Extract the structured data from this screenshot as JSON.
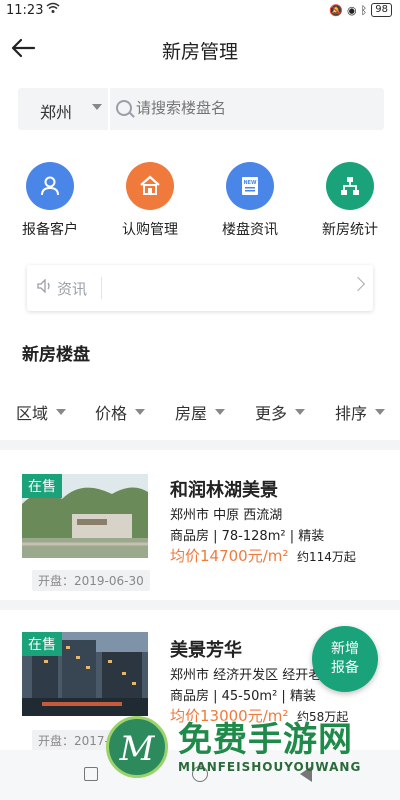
{
  "status_bar": {
    "time": "11:23",
    "battery": "98"
  },
  "header": {
    "title": "新房管理"
  },
  "search": {
    "city": "郑州",
    "placeholder": "请搜索楼盘名"
  },
  "quick_actions": [
    {
      "label": "报备客户",
      "icon": "user-icon",
      "color": "#4a86e8"
    },
    {
      "label": "认购管理",
      "icon": "house-icon",
      "color": "#f07a3c"
    },
    {
      "label": "楼盘资讯",
      "icon": "news-icon",
      "color": "#4a86e8"
    },
    {
      "label": "新房统计",
      "icon": "org-chart-icon",
      "color": "#1aa37a"
    }
  ],
  "news": {
    "label": "资讯"
  },
  "section": {
    "title": "新房楼盘"
  },
  "filters": [
    "区域",
    "价格",
    "房屋",
    "更多",
    "排序"
  ],
  "listings": [
    {
      "badge": "在售",
      "name": "和润林湖美景",
      "location": "郑州市 中原 西流湖",
      "type": "商品房 | 78-128m² | 精装",
      "price": "均价14700元/m²",
      "total": "约114万起",
      "open_date": "开盘：2019-06-30"
    },
    {
      "badge": "在售",
      "name": "美景芳华",
      "location": "郑州市 经济开发区 经开老",
      "type": "商品房 | 45-50m² | 精装",
      "price": "均价13000元/m²",
      "total": "约58万起",
      "open_date": "开盘：2017-10"
    }
  ],
  "fab": {
    "line1": "新增",
    "line2": "报备"
  },
  "watermark": {
    "title": "免费手游网",
    "subtitle": "MIANFEISHOUYOUWANG"
  },
  "colors": {
    "accent_green": "#1aa37a",
    "price_orange": "#f07a3c",
    "blue": "#4a86e8"
  }
}
